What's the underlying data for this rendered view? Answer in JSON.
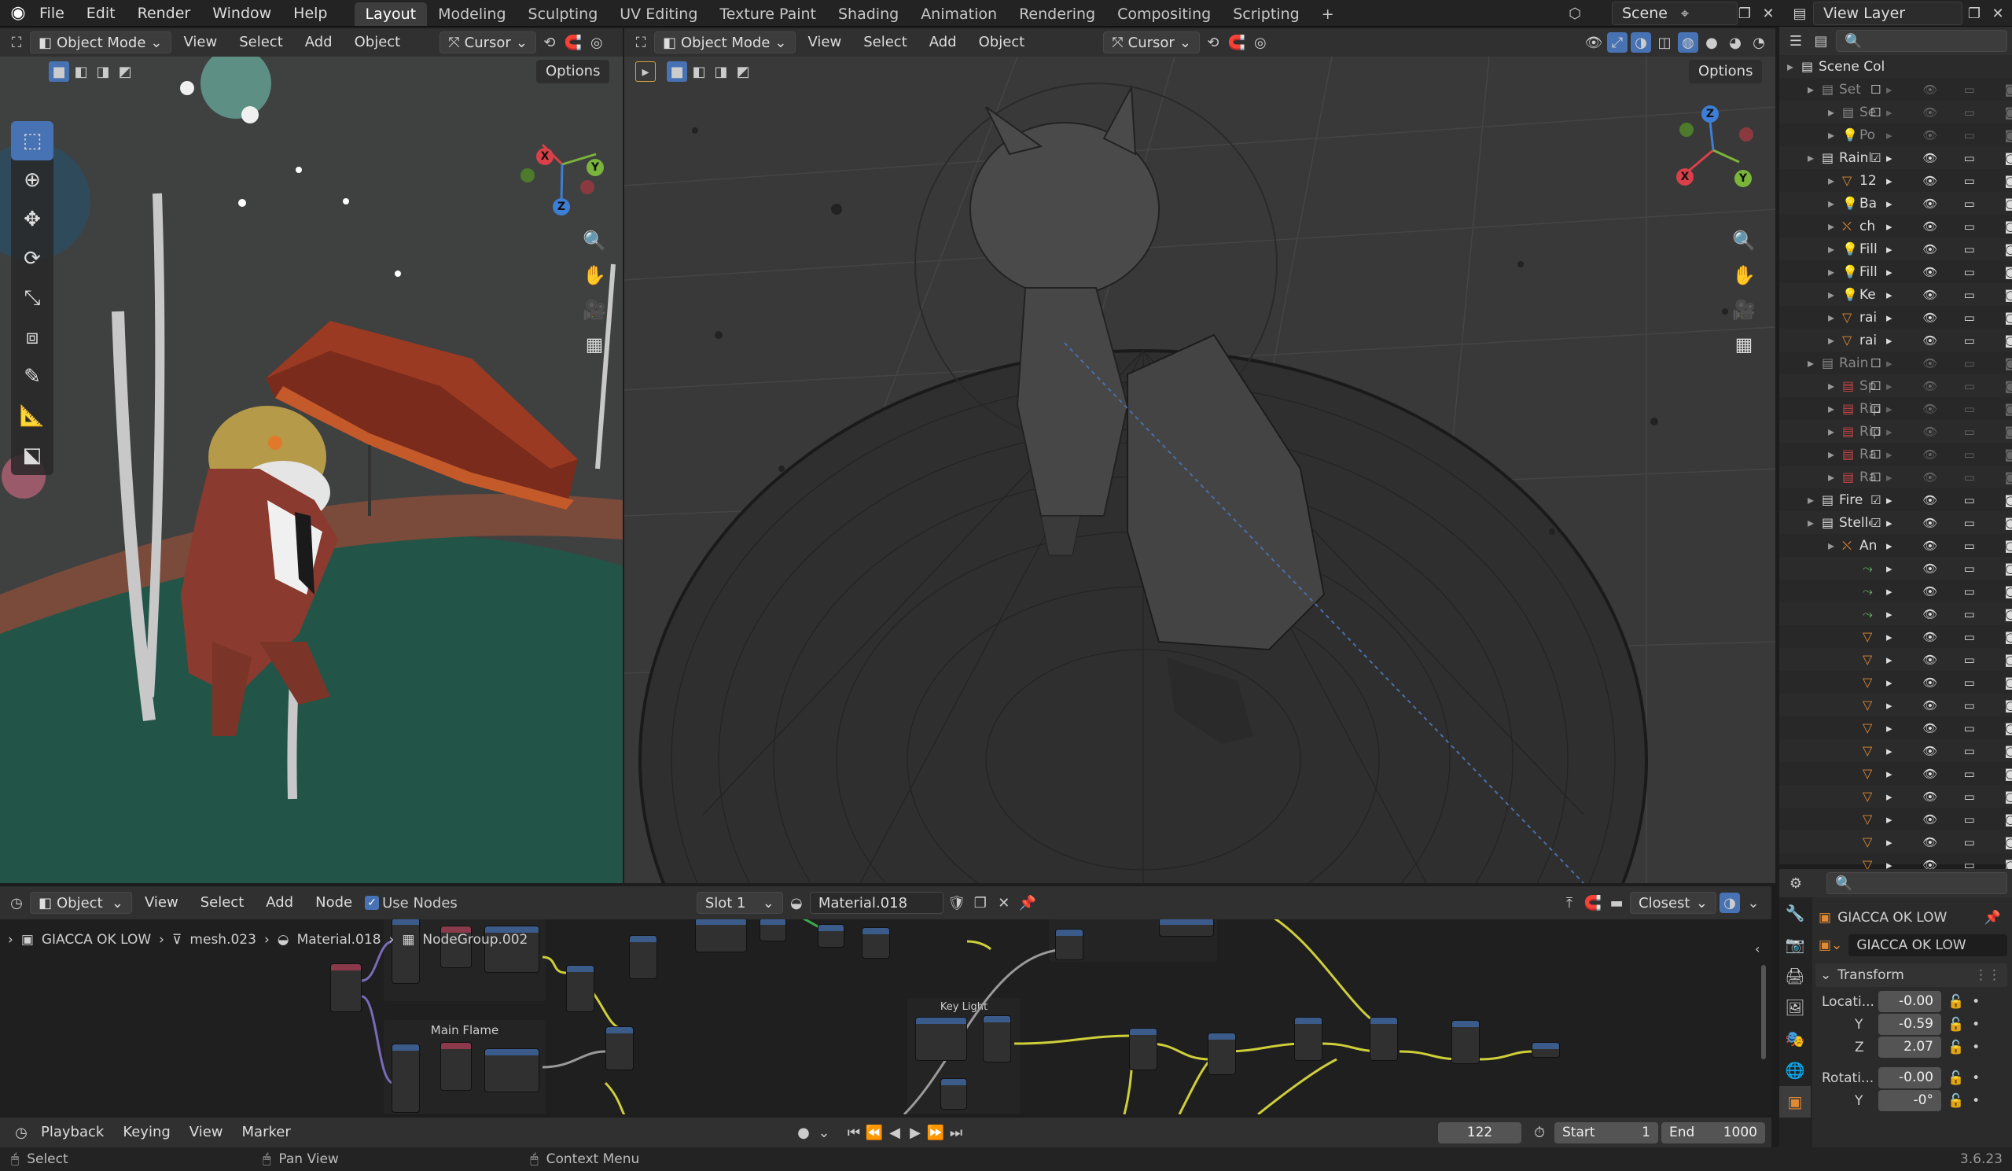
{
  "topbar": {
    "menus": [
      "File",
      "Edit",
      "Render",
      "Window",
      "Help"
    ],
    "workspaces": [
      "Layout",
      "Modeling",
      "Sculpting",
      "UV Editing",
      "Texture Paint",
      "Shading",
      "Animation",
      "Rendering",
      "Compositing",
      "Scripting"
    ],
    "active_workspace": "Layout",
    "add_tab": "+",
    "scene": "Scene",
    "view_layer": "View Layer"
  },
  "viewport_left": {
    "mode": "Object Mode",
    "menus": [
      "View",
      "Select",
      "Add",
      "Object"
    ],
    "transform_orientation": "Cursor",
    "options": "Options"
  },
  "viewport_right": {
    "mode": "Object Mode",
    "menus": [
      "View",
      "Select",
      "Add",
      "Object"
    ],
    "transform_orientation": "Cursor",
    "options": "Options"
  },
  "gizmo": {
    "x": "X",
    "y": "Y",
    "z": "Z"
  },
  "outliner": {
    "search_placeholder": "",
    "rows": [
      {
        "name": "Scene Col",
        "indent": 0,
        "icon": "collection",
        "color": "#ddd"
      },
      {
        "name": "Set",
        "indent": 1,
        "icon": "collection",
        "color": "#888",
        "dim": true
      },
      {
        "name": "Se",
        "indent": 2,
        "icon": "collection",
        "color": "#888",
        "dim": true
      },
      {
        "name": "Po",
        "indent": 2,
        "icon": "light",
        "color": "#c98a3e",
        "dim": true
      },
      {
        "name": "RainFX",
        "indent": 1,
        "icon": "collection",
        "color": "#ddd"
      },
      {
        "name": "12",
        "indent": 2,
        "icon": "mesh",
        "color": "#e08a34"
      },
      {
        "name": "Ba",
        "indent": 2,
        "icon": "light",
        "color": "#e08a34"
      },
      {
        "name": "ch",
        "indent": 2,
        "icon": "armature",
        "color": "#e08a34"
      },
      {
        "name": "Fill",
        "indent": 2,
        "icon": "light",
        "color": "#e08a34"
      },
      {
        "name": "Fill",
        "indent": 2,
        "icon": "light",
        "color": "#e08a34"
      },
      {
        "name": "Ke",
        "indent": 2,
        "icon": "light",
        "color": "#e08a34"
      },
      {
        "name": "rai",
        "indent": 2,
        "icon": "mesh",
        "color": "#e08a34"
      },
      {
        "name": "rai",
        "indent": 2,
        "icon": "mesh",
        "color": "#e08a34"
      },
      {
        "name": "Rain M",
        "indent": 1,
        "icon": "collection",
        "color": "#888",
        "dim": true
      },
      {
        "name": "Sp",
        "indent": 2,
        "icon": "collection",
        "color": "#c74545",
        "dim": true
      },
      {
        "name": "Rip",
        "indent": 2,
        "icon": "collection",
        "color": "#c74545",
        "dim": true
      },
      {
        "name": "Rip",
        "indent": 2,
        "icon": "collection",
        "color": "#c74545",
        "dim": true
      },
      {
        "name": "Ra",
        "indent": 2,
        "icon": "collection",
        "color": "#c74545",
        "dim": true
      },
      {
        "name": "Ra",
        "indent": 2,
        "icon": "collection",
        "color": "#c74545",
        "dim": true
      },
      {
        "name": "Fire",
        "indent": 1,
        "icon": "collection",
        "color": "#ddd"
      },
      {
        "name": "Stelle",
        "indent": 1,
        "icon": "collection",
        "color": "#ddd"
      },
      {
        "name": "An",
        "indent": 2,
        "icon": "armature",
        "color": "#e08a34"
      },
      {
        "name": "",
        "indent": 3,
        "icon": "pose",
        "color": "#6abf6a"
      },
      {
        "name": "",
        "indent": 3,
        "icon": "pose",
        "color": "#6abf6a"
      },
      {
        "name": "",
        "indent": 3,
        "icon": "pose",
        "color": "#6abf6a"
      },
      {
        "name": "",
        "indent": 3,
        "icon": "mesh",
        "color": "#e08a34"
      },
      {
        "name": "",
        "indent": 3,
        "icon": "mesh",
        "color": "#e08a34"
      },
      {
        "name": "",
        "indent": 3,
        "icon": "mesh",
        "color": "#e08a34"
      },
      {
        "name": "",
        "indent": 3,
        "icon": "mesh",
        "color": "#e08a34"
      },
      {
        "name": "",
        "indent": 3,
        "icon": "mesh",
        "color": "#e08a34"
      },
      {
        "name": "",
        "indent": 3,
        "icon": "mesh",
        "color": "#e08a34"
      },
      {
        "name": "",
        "indent": 3,
        "icon": "mesh",
        "color": "#e08a34"
      },
      {
        "name": "",
        "indent": 3,
        "icon": "mesh",
        "color": "#e08a34"
      },
      {
        "name": "",
        "indent": 3,
        "icon": "mesh",
        "color": "#e08a34"
      },
      {
        "name": "",
        "indent": 3,
        "icon": "mesh",
        "color": "#e08a34"
      },
      {
        "name": "",
        "indent": 3,
        "icon": "mesh",
        "color": "#e08a34"
      }
    ]
  },
  "properties": {
    "object_name": "GIACCA OK LOW",
    "data_name": "GIACCA OK LOW",
    "panel": "Transform",
    "location_label": "Locati...",
    "rotation_label": "Rotati...",
    "loc": [
      {
        "axis": "",
        "val": "-0.00"
      },
      {
        "axis": "Y",
        "val": "-0.59"
      },
      {
        "axis": "Z",
        "val": "2.07"
      }
    ],
    "rot": [
      {
        "axis": "",
        "val": "-0.00"
      },
      {
        "axis": "Y",
        "val": "-0°"
      }
    ]
  },
  "node_editor": {
    "type": "Object",
    "menus": [
      "View",
      "Select",
      "Add",
      "Node"
    ],
    "use_nodes": "Use Nodes",
    "slot": "Slot 1",
    "material": "Material.018",
    "snap": "Closest",
    "breadcrumb": [
      "GIACCA OK LOW",
      "mesh.023",
      "Material.018",
      "NodeGroup.002"
    ],
    "frames": [
      "Main Flame",
      "Key Light"
    ]
  },
  "timeline": {
    "menus": [
      "Playback",
      "Keying",
      "View",
      "Marker"
    ],
    "current_frame": "122",
    "start_label": "Start",
    "start": "1",
    "end_label": "End",
    "end": "1000"
  },
  "status": {
    "items": [
      "Select",
      "Pan View",
      "Context Menu"
    ],
    "version": "3.6.23"
  }
}
